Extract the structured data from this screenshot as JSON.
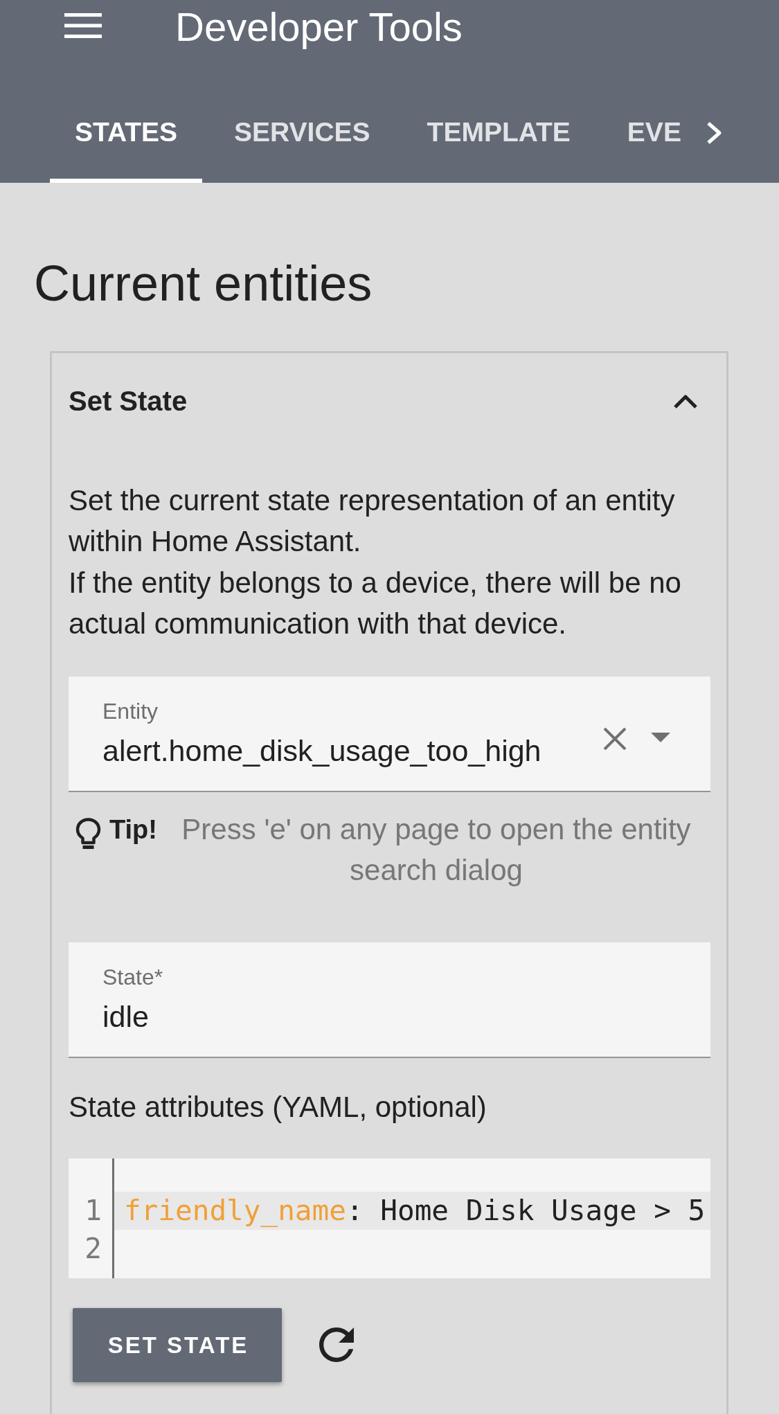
{
  "header": {
    "title": "Developer Tools",
    "tabs": [
      {
        "label": "STATES",
        "selected": true
      },
      {
        "label": "SERVICES",
        "selected": false
      },
      {
        "label": "TEMPLATE",
        "selected": false
      },
      {
        "label": "EVE",
        "selected": false
      }
    ]
  },
  "page_title": "Current entities",
  "set_state_panel": {
    "title": "Set State",
    "expanded": true,
    "description": [
      "Set the current state representation of an entity within Home Assistant.",
      "If the entity belongs to a device, there will be no actual communication with that device."
    ],
    "entity_field": {
      "kind": "combobox",
      "label": "Entity",
      "value": "alert.home_disk_usage_too_high"
    },
    "tip": {
      "label": "Tip!",
      "text": "Press 'e' on any page to open the entity search dialog"
    },
    "state_field": {
      "label": "State*",
      "value": "idle"
    },
    "attributes_label": "State attributes (YAML, optional)",
    "attributes_editor": {
      "lines": [
        {
          "number": "1",
          "key": "friendly_name",
          "text": ": Home Disk Usage > 5",
          "active": true
        },
        {
          "number": "2",
          "active": false
        }
      ]
    },
    "submit_button": "SET STATE"
  }
}
